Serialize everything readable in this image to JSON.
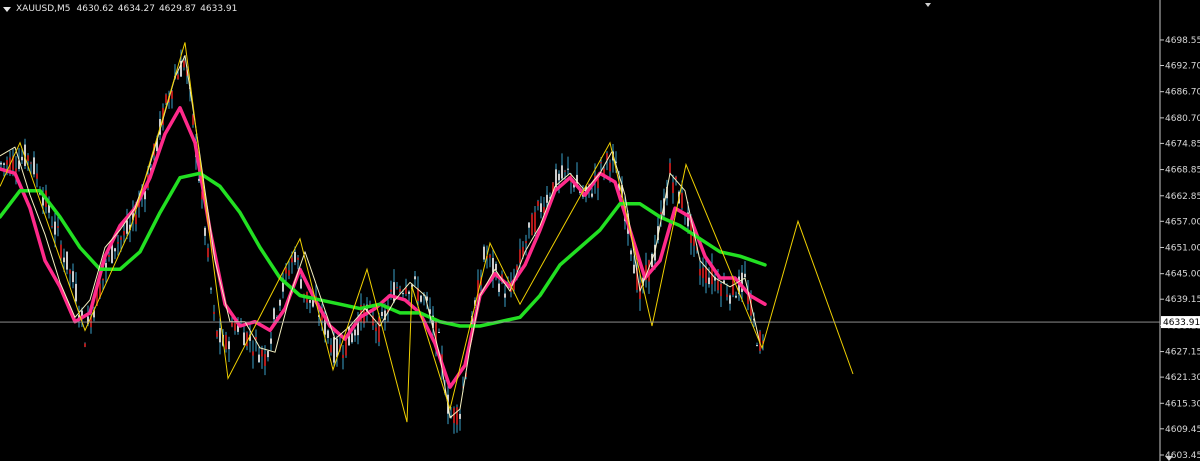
{
  "header": {
    "symbol": "XAUUSD,M5",
    "open": "4630.62",
    "high": "4634.27",
    "low": "4629.87",
    "close": "4633.91"
  },
  "colors": {
    "background": "#000000",
    "axis": "#c8c8c8",
    "bull_candle": "#ffffff",
    "bear_candle": "#e02020",
    "wick": "#3aa0c8",
    "ma_fast": "#ff2a8a",
    "ma_slow": "#22e022",
    "zigzag": "#f0d000",
    "thin_ma": "#f5f0c0",
    "price_line": "#a0a0a0",
    "price_tag_bg": "#ffffff"
  },
  "chart_data": {
    "type": "line",
    "y_axis_position": "right",
    "ylim": [
      4603.45,
      4704.5
    ],
    "y_ticks": [
      "4698.55",
      "4692.70",
      "4686.70",
      "4680.70",
      "4674.85",
      "4668.85",
      "4662.85",
      "4657.00",
      "4651.00",
      "4645.00",
      "4639.15",
      "4633.15",
      "4627.15",
      "4621.30",
      "4615.30",
      "4609.45",
      "4603.45"
    ],
    "current_price": "4633.91",
    "x_range": [
      0,
      1155
    ],
    "candles": {
      "x": [
        0,
        30,
        45,
        60,
        75,
        85,
        100,
        115,
        130,
        150,
        165,
        175,
        185,
        195,
        205,
        215,
        225,
        235,
        250,
        265,
        280,
        295,
        305,
        320,
        335,
        350,
        365,
        380,
        395,
        410,
        425,
        440,
        450,
        460,
        470,
        485,
        495,
        510,
        525,
        540,
        555,
        570,
        585,
        600,
        612,
        625,
        640,
        655,
        670,
        685,
        700,
        715,
        730,
        745,
        755,
        765
      ],
      "y": [
        4670,
        4672,
        4662,
        4652,
        4642,
        4631,
        4642,
        4652,
        4655,
        4668,
        4683,
        4690,
        4694,
        4676,
        4655,
        4632,
        4628,
        4634,
        4630,
        4626,
        4640,
        4650,
        4640,
        4636,
        4627,
        4630,
        4637,
        4632,
        4642,
        4643,
        4639,
        4628,
        4612,
        4614,
        4630,
        4650,
        4645,
        4640,
        4652,
        4660,
        4666,
        4668,
        4662,
        4668,
        4672,
        4660,
        4640,
        4650,
        4668,
        4660,
        4646,
        4644,
        4641,
        4643,
        4632,
        4627
      ]
    },
    "series": [
      {
        "x": [
          0,
          15,
          30,
          45,
          60,
          75,
          90,
          105,
          120,
          135,
          150,
          165,
          180,
          195,
          210,
          225,
          240,
          255,
          270,
          285,
          300,
          315,
          330,
          345,
          360,
          375,
          390,
          405,
          420,
          435,
          450,
          465,
          480,
          495,
          510,
          525,
          540,
          555,
          570,
          585,
          600,
          615,
          630,
          645,
          660,
          675,
          690,
          705,
          720,
          735,
          750,
          765
        ],
        "values": [
          4669,
          4668,
          4660,
          4648,
          4642,
          4634,
          4636,
          4649,
          4656,
          4660,
          4667,
          4677,
          4683,
          4675,
          4655,
          4638,
          4633,
          4634,
          4632,
          4637,
          4646,
          4639,
          4633,
          4630,
          4635,
          4637,
          4640,
          4639,
          4636,
          4629,
          4619,
          4624,
          4640,
          4645,
          4642,
          4647,
          4655,
          4664,
          4667,
          4663,
          4668,
          4666,
          4655,
          4644,
          4648,
          4660,
          4658,
          4649,
          4644,
          4644,
          4640,
          4638
        ]
      },
      {
        "x": [
          0,
          20,
          40,
          60,
          80,
          100,
          120,
          140,
          160,
          180,
          200,
          220,
          240,
          260,
          280,
          300,
          320,
          340,
          360,
          380,
          400,
          420,
          440,
          460,
          480,
          500,
          520,
          540,
          560,
          580,
          600,
          620,
          640,
          660,
          680,
          700,
          720,
          740,
          765
        ],
        "values": [
          4658,
          4664,
          4664,
          4658,
          4651,
          4646,
          4646,
          4650,
          4659,
          4667,
          4668,
          4665,
          4659,
          4651,
          4644,
          4640,
          4639,
          4638,
          4637,
          4638,
          4636,
          4636,
          4634,
          4633,
          4633,
          4634,
          4635,
          4640,
          4647,
          4651,
          4655,
          4661,
          4661,
          4658,
          4656,
          4653,
          4650,
          4649,
          4647
        ]
      },
      {
        "x": [
          0,
          15,
          30,
          45,
          60,
          75,
          90,
          105,
          120,
          135,
          150,
          165,
          175,
          185,
          200,
          215,
          230,
          245,
          260,
          275,
          290,
          305,
          320,
          335,
          350,
          365,
          380,
          395,
          410,
          425,
          440,
          450,
          460,
          470,
          480,
          495,
          510,
          525,
          540,
          555,
          570,
          585,
          600,
          612,
          625,
          640,
          655,
          670,
          685,
          700,
          715,
          730,
          745,
          760
        ],
        "values": [
          4672,
          4674,
          4663,
          4654,
          4643,
          4635,
          4639,
          4651,
          4655,
          4660,
          4670,
          4682,
          4690,
          4695,
          4672,
          4648,
          4634,
          4634,
          4628,
          4627,
          4640,
          4650,
          4640,
          4630,
          4633,
          4637,
          4633,
          4639,
          4643,
          4640,
          4626,
          4612,
          4614,
          4628,
          4640,
          4646,
          4641,
          4650,
          4656,
          4665,
          4668,
          4664,
          4668,
          4673,
          4663,
          4641,
          4650,
          4668,
          4664,
          4648,
          4644,
          4642,
          4644,
          4629
        ]
      }
    ],
    "zigzag": {
      "x": [
        0,
        20,
        35,
        85,
        130,
        185,
        228,
        300,
        333,
        367,
        407,
        412,
        450,
        490,
        520,
        610,
        652,
        686,
        762,
        798,
        853
      ],
      "values": [
        4665,
        4675,
        4665,
        4632,
        4655,
        4698,
        4621,
        4653,
        4623,
        4646,
        4611,
        4642,
        4614,
        4652,
        4638,
        4675,
        4633,
        4670,
        4628,
        4657,
        4622
      ]
    }
  }
}
